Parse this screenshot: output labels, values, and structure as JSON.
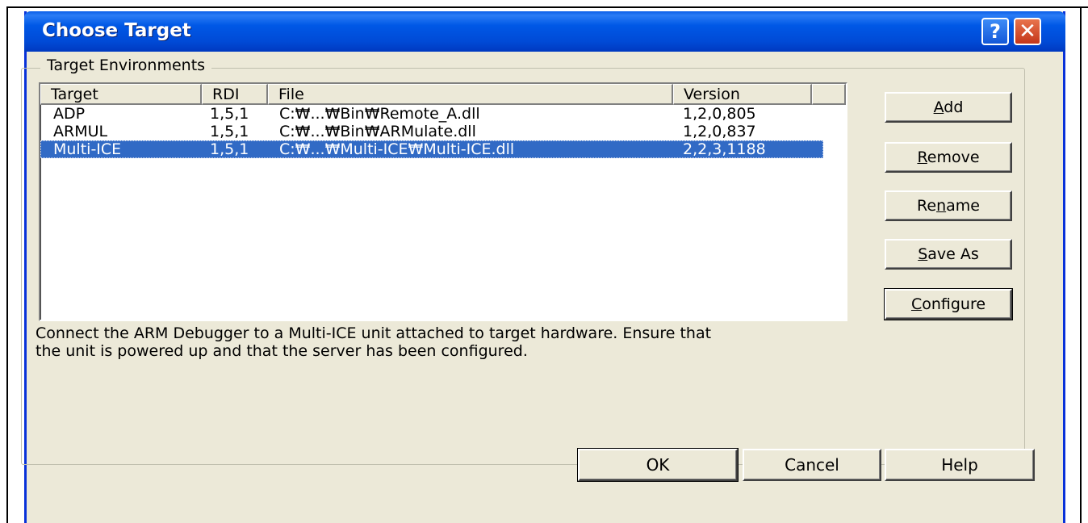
{
  "window": {
    "title": "Choose Target"
  },
  "titlebar_buttons": {
    "help_glyph": "?",
    "close_glyph": "✕"
  },
  "group": {
    "legend": "Target Environments"
  },
  "list": {
    "columns": [
      "Target",
      "RDI",
      "File",
      "Version"
    ],
    "rows": [
      {
        "target": "ADP",
        "rdi": "1,5,1",
        "file": "C:₩...₩Bin₩Remote_A.dll",
        "version": "1,2,0,805",
        "selected": false
      },
      {
        "target": "ARMUL",
        "rdi": "1,5,1",
        "file": "C:₩...₩Bin₩ARMulate.dll",
        "version": "1,2,0,837",
        "selected": false
      },
      {
        "target": "Multi-ICE",
        "rdi": "1,5,1",
        "file": "C:₩...₩Multi-ICE₩Multi-ICE.dll",
        "version": "2,2,3,1188",
        "selected": true
      }
    ],
    "selection_color": "#316ac5"
  },
  "side_buttons": [
    {
      "label": "Add",
      "mnemonic_index": 0
    },
    {
      "label": "Remove",
      "mnemonic_index": 0
    },
    {
      "label": "Rename",
      "mnemonic_index": 2
    },
    {
      "label": "Save As",
      "mnemonic_index": 0
    },
    {
      "label": "Configure",
      "mnemonic_index": 0
    }
  ],
  "description": {
    "line1": "Connect the ARM Debugger to a Multi-ICE unit attached to target hardware.  Ensure that",
    "line2": "the unit is powered up and that the server has been configured."
  },
  "bottom_buttons": {
    "ok": "OK",
    "cancel": "Cancel",
    "help": "Help"
  },
  "colors": {
    "titlebar": "#0058e6",
    "dialog_bg": "#ece9d8",
    "border": "#0831d9"
  }
}
